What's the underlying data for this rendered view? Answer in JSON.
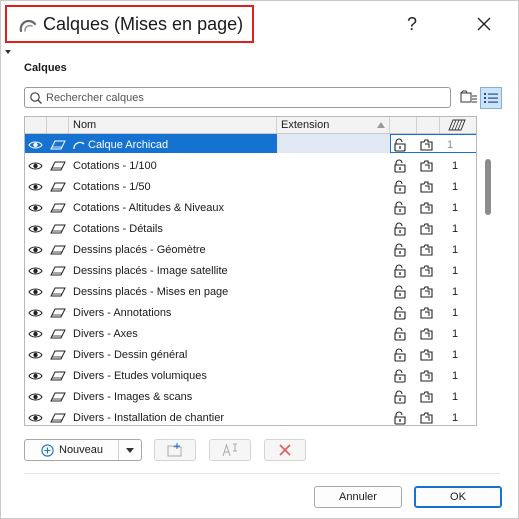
{
  "window": {
    "title": "Calques (Mises en page)",
    "help_label": "?",
    "title_icon": "archicad-arc-icon",
    "close_icon": "close-icon",
    "highlight_color": "#e02020"
  },
  "section": {
    "label": "Calques"
  },
  "search": {
    "placeholder": "Rechercher calques",
    "value": ""
  },
  "table": {
    "columns": [
      {
        "label": ""
      },
      {
        "label": ""
      },
      {
        "label": "Nom"
      },
      {
        "label": "Extension"
      },
      {
        "label": ""
      },
      {
        "label": ""
      },
      {
        "label": ""
      }
    ],
    "rows": [
      {
        "name": "Calque Archicad",
        "intersection": "1",
        "selected": true
      },
      {
        "name": "Cotations - 1/100",
        "intersection": "1"
      },
      {
        "name": "Cotations - 1/50",
        "intersection": "1"
      },
      {
        "name": "Cotations - Altitudes & Niveaux",
        "intersection": "1"
      },
      {
        "name": "Cotations - Détails",
        "intersection": "1"
      },
      {
        "name": "Dessins placés - Géomètre",
        "intersection": "1"
      },
      {
        "name": "Dessins placés - Image satellite",
        "intersection": "1"
      },
      {
        "name": "Dessins placés - Mises en page",
        "intersection": "1"
      },
      {
        "name": "Divers - Annotations",
        "intersection": "1"
      },
      {
        "name": "Divers - Axes",
        "intersection": "1"
      },
      {
        "name": "Divers - Dessin général",
        "intersection": "1"
      },
      {
        "name": "Divers - Etudes volumiques",
        "intersection": "1"
      },
      {
        "name": "Divers - Images & scans",
        "intersection": "1"
      },
      {
        "name": "Divers - Installation de chantier",
        "intersection": "1"
      }
    ]
  },
  "toolbar": {
    "new_label": "Nouveau"
  },
  "buttons": {
    "cancel_label": "Annuler",
    "ok_label": "OK"
  },
  "colors": {
    "selection": "#1572d1",
    "accent_blue": "#1572d1",
    "delete_red": "#e06060"
  }
}
